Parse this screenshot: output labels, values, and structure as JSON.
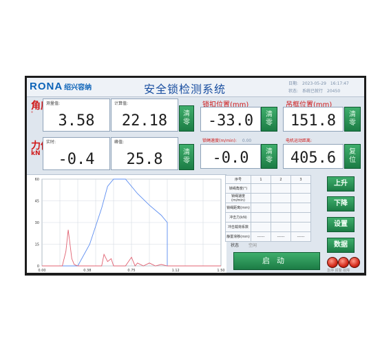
{
  "header": {
    "logo": "RONA",
    "logo_cn": "绍兴容纳",
    "title": "安全锁检测系统",
    "date_label": "日期:",
    "date_value": "2023-05-29",
    "time_value": "16:17:47",
    "status_label": "状态:",
    "status_value": "系统已就行",
    "extra_value": "20450"
  },
  "angle": {
    "label": "角度",
    "unit": "°",
    "measured_caption": "测量值:",
    "measured_value": "3.58",
    "calc_caption": "计算值:",
    "calc_value": "22.18",
    "clear_label": "清零"
  },
  "lock_position": {
    "label": "锁扣位置(mm)",
    "value": "-33.0",
    "clear_label": "清零"
  },
  "frame_position": {
    "label": "吊框位置(mm)",
    "value": "151.8",
    "clear_label": "清零"
  },
  "force": {
    "label": "力值",
    "unit": "kN",
    "realtime_caption": "实时:",
    "realtime_value": "-0.4",
    "peak_caption": "峰值:",
    "peak_value": "25.8",
    "clear_label": "清零"
  },
  "lock_speed": {
    "label": "锁绳速度(m/min):",
    "set_value": "0.00",
    "value": "-0.0",
    "clear_label": "清零"
  },
  "motor_distance": {
    "label": "电机运动距离:",
    "value": "405.6",
    "reset_label": "复位"
  },
  "chart_data": {
    "type": "line",
    "x_ticks": [
      "0.00",
      "0.38",
      "0.75",
      "1.12",
      "1.50"
    ],
    "y_ticks": [
      "0",
      "15",
      "30",
      "45",
      "60"
    ],
    "xlim": [
      0,
      1.5
    ],
    "ylim": [
      0,
      60
    ],
    "grid": true,
    "series": [
      {
        "color": "#5b8cf0",
        "x": [
          0.0,
          0.3,
          0.4,
          0.5,
          0.55,
          0.6,
          0.7,
          0.8,
          0.9,
          1.0,
          1.05,
          1.05,
          1.12,
          1.5
        ],
        "y": [
          0,
          0,
          15,
          40,
          55,
          60,
          60,
          50,
          42,
          35,
          30,
          0,
          0,
          0
        ]
      },
      {
        "color": "#e06070",
        "x": [
          0.0,
          0.17,
          0.2,
          0.22,
          0.25,
          0.27,
          0.3,
          0.5,
          0.52,
          0.55,
          0.58,
          0.6,
          0.7,
          0.75,
          0.78,
          0.8,
          0.85,
          0.9,
          0.95,
          1.0,
          1.05,
          1.5
        ],
        "y": [
          0,
          0,
          10,
          25,
          5,
          1,
          0,
          0,
          8,
          3,
          5,
          0,
          0,
          6,
          0,
          2,
          0,
          2,
          0,
          1,
          0,
          0
        ]
      }
    ]
  },
  "table": {
    "header": [
      "序号",
      "1",
      "2",
      "3"
    ],
    "rows": [
      [
        "锁绳角度(°)",
        "",
        "",
        ""
      ],
      [
        "锁绳速度(m/min)",
        "",
        "",
        ""
      ],
      [
        "锁绳距离(mm)",
        "",
        "",
        ""
      ],
      [
        "冲击力(kN)",
        "",
        "",
        ""
      ],
      [
        "冲击载荷系数",
        "",
        "",
        ""
      ],
      [
        "静置滑移(mm)",
        "------",
        "------",
        "------"
      ]
    ],
    "state_label": "状态",
    "state_value": "空闲"
  },
  "buttons": {
    "up": "上升",
    "down": "下降",
    "settings": "设置",
    "data": "数据",
    "start": "启动"
  },
  "lamps_label": "急停 报警 故障",
  "colors": {
    "accent_blue": "#1a4fa0",
    "label_red": "#d01a1a",
    "button_green": "#2a9458"
  }
}
